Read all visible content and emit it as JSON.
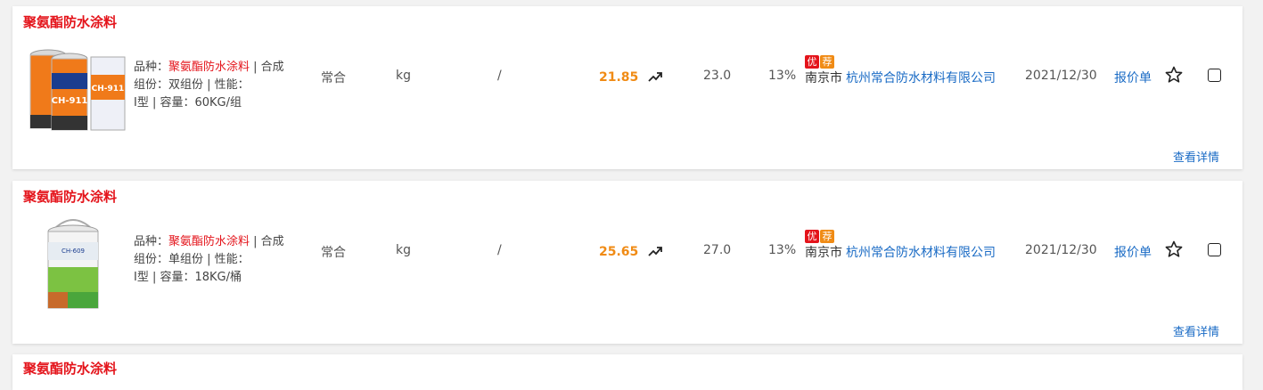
{
  "products": [
    {
      "title": "聚氨酯防水涂料",
      "image_label": "CH-911",
      "spec_prefix": "品种：",
      "spec_variety": "聚氨酯防水涂料",
      "spec_rest1": " | 合成组份：双组份 | 性能：",
      "spec_rest2": "Ⅰ型 | 容量：60KG/组",
      "brand": "常合",
      "unit": "kg",
      "model": "/",
      "price": "21.85",
      "ref_price": "23.0",
      "tax": "13%",
      "badge_you": "优",
      "badge_jian": "荐",
      "city": "南京市",
      "company": "杭州常合防水材料有限公司",
      "date": "2021/12/30",
      "quote_label": "报价单",
      "detail_label": "查看详情"
    },
    {
      "title": "聚氨酯防水涂料",
      "image_label": "CH-609",
      "spec_prefix": "品种：",
      "spec_variety": "聚氨酯防水涂料",
      "spec_rest1": " | 合成组份：单组份 | 性能：",
      "spec_rest2": "Ⅰ型 | 容量：18KG/桶",
      "brand": "常合",
      "unit": "kg",
      "model": "/",
      "price": "25.65",
      "ref_price": "27.0",
      "tax": "13%",
      "badge_you": "优",
      "badge_jian": "荐",
      "city": "南京市",
      "company": "杭州常合防水材料有限公司",
      "date": "2021/12/30",
      "quote_label": "报价单",
      "detail_label": "查看详情"
    },
    {
      "title": "聚氨酯防水涂料"
    }
  ],
  "colors": {
    "title_red": "#e4141b",
    "price_orange": "#f08b15",
    "link_blue": "#1a6bc5"
  },
  "icons": {
    "trend": "trend-up-icon",
    "star": "star-outline-icon",
    "checkbox": "checkbox-icon"
  }
}
